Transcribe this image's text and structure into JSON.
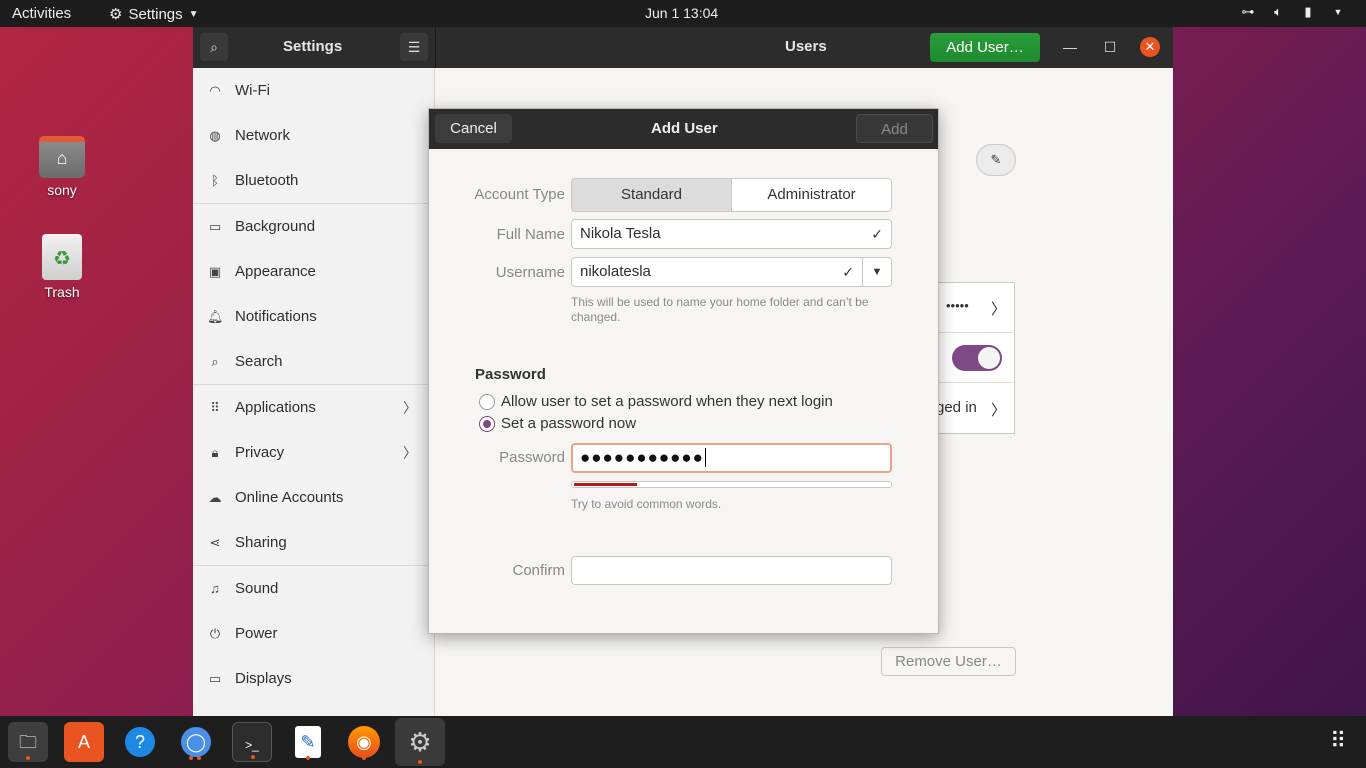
{
  "topbar": {
    "activities": "Activities",
    "app_menu": "Settings",
    "clock": "Jun 1  13:04"
  },
  "desktop": {
    "home_label": "sony",
    "trash_label": "Trash"
  },
  "window": {
    "sidebar_title": "Settings",
    "panel_title": "Users",
    "add_user_button": "Add User…",
    "remove_user_button": "Remove User…",
    "panel_row_password": "•••••",
    "panel_row_login": "ged in"
  },
  "sidebar": {
    "items": [
      {
        "label": "Wi-Fi",
        "icon": "wifi-icon"
      },
      {
        "label": "Network",
        "icon": "network-icon"
      },
      {
        "label": "Bluetooth",
        "icon": "bluetooth-icon"
      },
      {
        "label": "Background",
        "icon": "background-icon"
      },
      {
        "label": "Appearance",
        "icon": "appearance-icon"
      },
      {
        "label": "Notifications",
        "icon": "bell-icon"
      },
      {
        "label": "Search",
        "icon": "search-icon"
      },
      {
        "label": "Applications",
        "icon": "apps-icon"
      },
      {
        "label": "Privacy",
        "icon": "lock-icon"
      },
      {
        "label": "Online Accounts",
        "icon": "cloud-icon"
      },
      {
        "label": "Sharing",
        "icon": "share-icon"
      },
      {
        "label": "Sound",
        "icon": "music-icon"
      },
      {
        "label": "Power",
        "icon": "power-icon"
      },
      {
        "label": "Displays",
        "icon": "display-icon"
      }
    ]
  },
  "dialog": {
    "title": "Add User",
    "cancel": "Cancel",
    "add": "Add",
    "account_type_label": "Account Type",
    "account_type_options": [
      "Standard",
      "Administrator"
    ],
    "account_type_selected": "Standard",
    "full_name_label": "Full Name",
    "full_name_value": "Nikola Tesla",
    "username_label": "Username",
    "username_value": "nikolatesla",
    "username_hint": "This will be used to name your home folder and can’t be changed.",
    "password_section": "Password",
    "radio_later": "Allow user to set a password when they next login",
    "radio_now": "Set a password now",
    "radio_selected": "now",
    "password_label": "Password",
    "password_value": "●●●●●●●●●●●",
    "password_strength": 0.2,
    "password_hint": "Try to avoid common words.",
    "confirm_label": "Confirm",
    "confirm_value": ""
  },
  "colors": {
    "accent": "#e95420",
    "purple": "#7d4a85",
    "add_user_green": "#26a269"
  }
}
